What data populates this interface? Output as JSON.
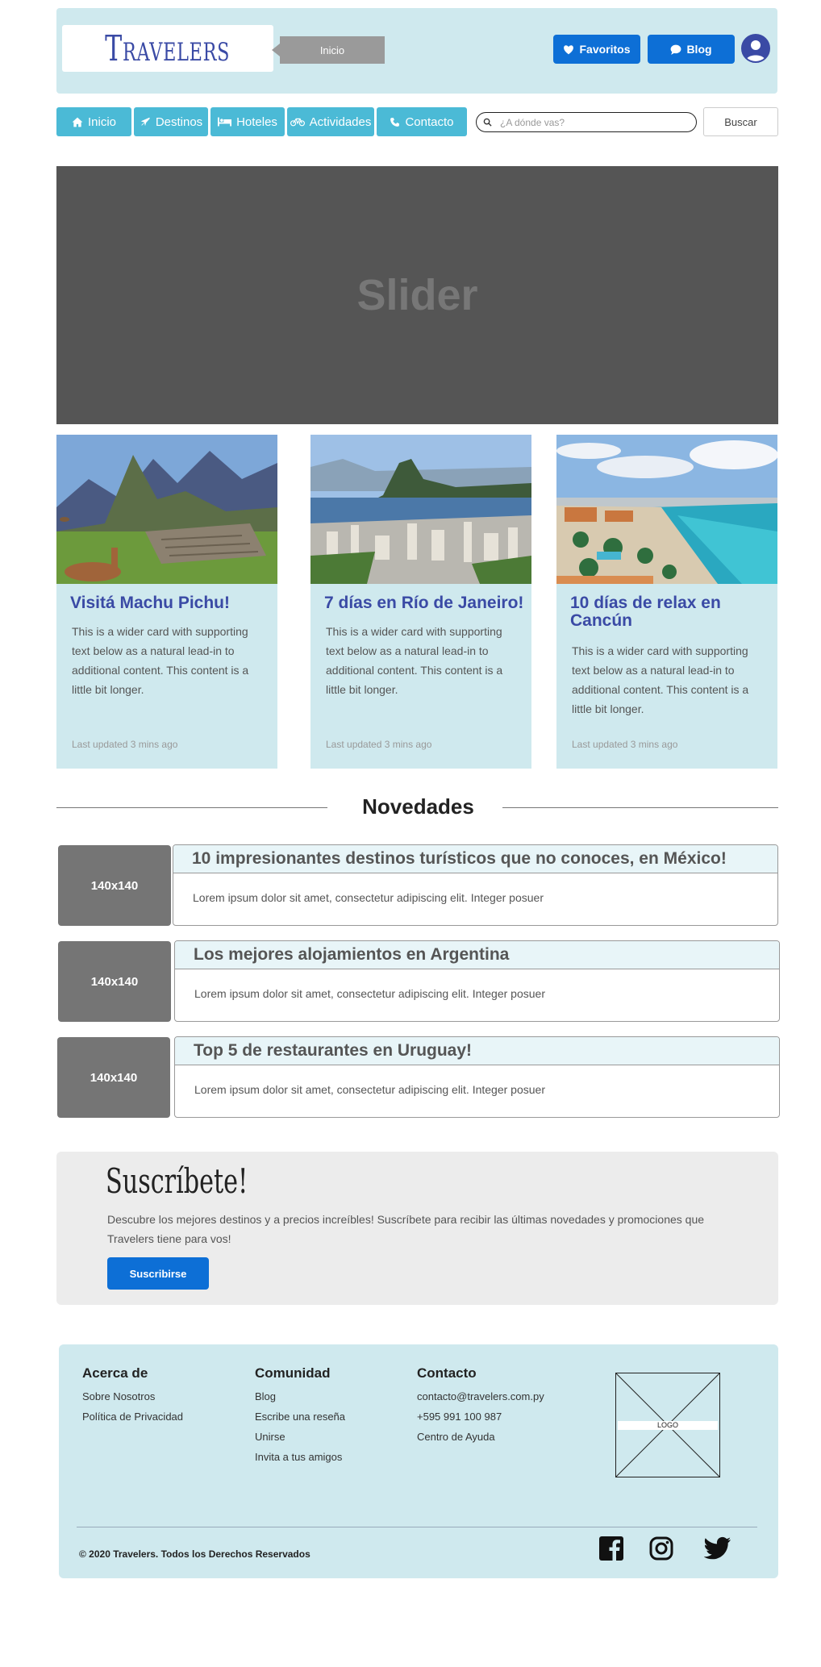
{
  "header": {
    "logo_text": "Travelers",
    "tooltip": "Inicio",
    "favoritos_label": "Favoritos",
    "blog_label": "Blog"
  },
  "nav": {
    "items": [
      {
        "label": "Inicio",
        "icon": "home-icon"
      },
      {
        "label": "Destinos",
        "icon": "plane-icon"
      },
      {
        "label": "Hoteles",
        "icon": "bed-icon"
      },
      {
        "label": "Actividades",
        "icon": "bicycle-icon"
      },
      {
        "label": "Contacto",
        "icon": "phone-icon"
      }
    ],
    "search_placeholder": "¿A dónde vas?",
    "search_button": "Buscar"
  },
  "slider": {
    "label": "Slider"
  },
  "cards": [
    {
      "title": "Visitá Machu Pichu!",
      "text": "This is a wider card with supporting text below as a natural lead-in to additional content. This content is a little bit longer.",
      "updated": "Last updated 3 mins ago"
    },
    {
      "title": "7 días en Río de Janeiro!",
      "text": "This is a wider card with supporting text below as a natural lead-in to additional content. This content is a little bit longer.",
      "updated": "Last updated 3 mins ago"
    },
    {
      "title": "10 días de relax en Cancún",
      "text": "This is a wider card with supporting text below as a natural lead-in to additional content. This content is a little bit longer.",
      "updated": "Last updated 3 mins ago"
    }
  ],
  "novedades": {
    "title": "Novedades",
    "items": [
      {
        "thumb": "140x140",
        "title": "10 impresionantes destinos turísticos que no conoces, en México!",
        "body": "Lorem ipsum dolor sit amet, consectetur adipiscing elit. Integer posuer"
      },
      {
        "thumb": "140x140",
        "title": "Los mejores alojamientos en Argentina",
        "body": "Lorem ipsum dolor sit amet, consectetur adipiscing elit. Integer posuer"
      },
      {
        "thumb": "140x140",
        "title": "Top 5 de restaurantes en Uruguay!",
        "body": "Lorem ipsum dolor sit amet, consectetur adipiscing elit. Integer posuer"
      }
    ]
  },
  "subscribe": {
    "title": "Suscríbete!",
    "text": "Descubre los mejores destinos y a precios increíbles! Suscríbete para recibir las últimas novedades y promociones que Travelers tiene para vos!",
    "button": "Suscribirse"
  },
  "footer": {
    "columns": [
      {
        "heading": "Acerca de",
        "links": [
          "Sobre Nosotros",
          "Política de Privacidad"
        ]
      },
      {
        "heading": "Comunidad",
        "links": [
          "Blog",
          "Escribe una reseña",
          "Unirse",
          "Invita a tus amigos"
        ]
      },
      {
        "heading": "Contacto",
        "links": [
          "contacto@travelers.com.py",
          "+595 991 100 987",
          "Centro de Ayuda"
        ]
      }
    ],
    "logo_label": "LOGO",
    "copyright": "© 2020 Travelers. Todos los Derechos Reservados",
    "social": [
      "facebook-icon",
      "instagram-icon",
      "twitter-icon"
    ]
  },
  "colors": {
    "accent_blue": "#0d6fd6",
    "nav_blue": "#4bbad6",
    "header_bg": "#cfe9ee",
    "title_blue": "#3a4aa5"
  }
}
